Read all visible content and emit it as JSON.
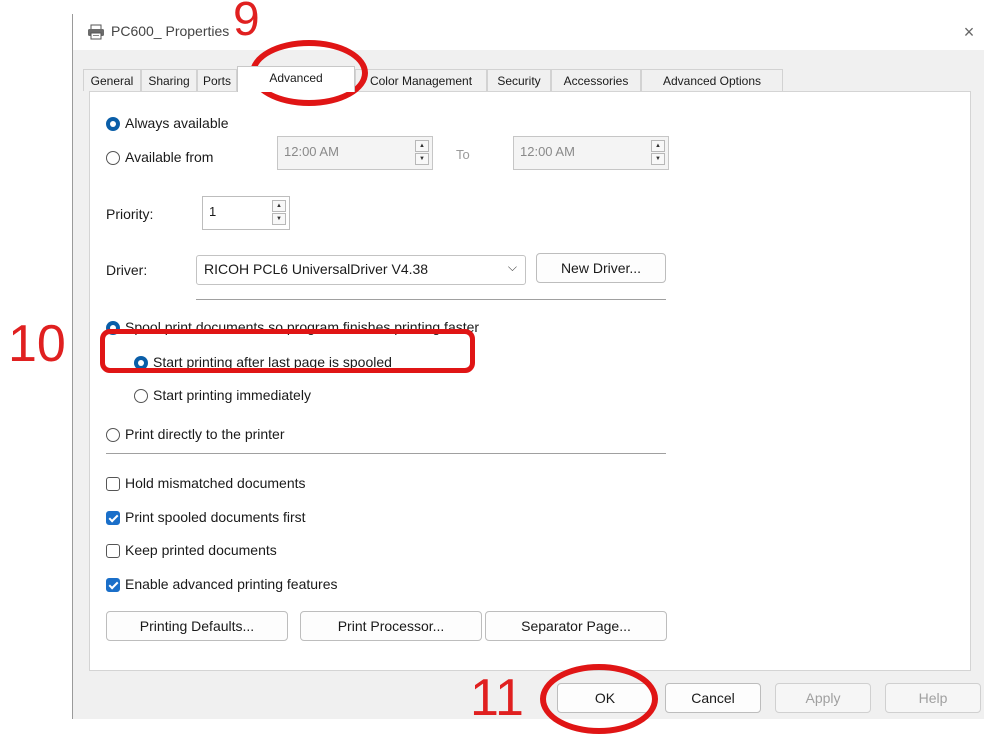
{
  "window": {
    "title": "PC600_ Properties",
    "close_glyph": "×"
  },
  "tabs": [
    {
      "label": "General"
    },
    {
      "label": "Sharing"
    },
    {
      "label": "Ports"
    },
    {
      "label": "Advanced"
    },
    {
      "label": "Color Management"
    },
    {
      "label": "Security"
    },
    {
      "label": "Accessories"
    },
    {
      "label": "Advanced Options"
    }
  ],
  "availability": {
    "always_label": "Always available",
    "from_label": "Available from",
    "from_time": "12:00 AM",
    "to_label": "To",
    "to_time": "12:00 AM"
  },
  "priority": {
    "label": "Priority:",
    "value": "1"
  },
  "driver": {
    "label": "Driver:",
    "value": "RICOH PCL6 UniversalDriver V4.38",
    "new_driver_label": "New Driver..."
  },
  "spool": {
    "spool_label": "Spool print documents so program finishes printing faster",
    "after_last_label": "Start printing after last page is spooled",
    "immediately_label": "Start printing immediately",
    "direct_label": "Print directly to the printer"
  },
  "options": {
    "hold_label": "Hold mismatched documents",
    "hold_checked": false,
    "spooled_first_label": "Print spooled documents first",
    "spooled_first_checked": true,
    "keep_label": "Keep printed documents",
    "keep_checked": false,
    "advanced_label": "Enable advanced printing features",
    "advanced_checked": true
  },
  "buttons": {
    "printing_defaults": "Printing Defaults...",
    "print_processor": "Print Processor...",
    "separator_page": "Separator Page...",
    "ok": "OK",
    "cancel": "Cancel",
    "apply": "Apply",
    "help": "Help"
  },
  "annotations": {
    "step9": "9",
    "step10": "10",
    "step11": "11",
    "color": "#e01515"
  }
}
